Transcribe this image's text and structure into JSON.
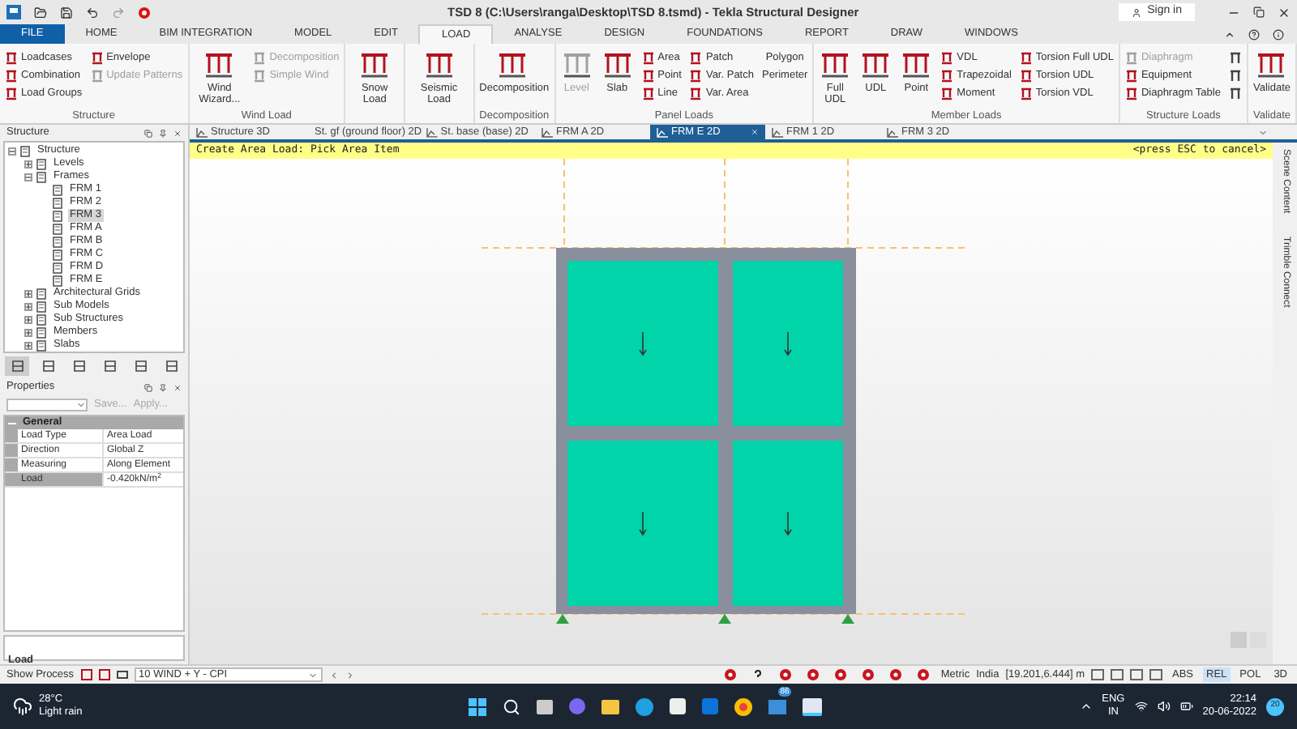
{
  "window": {
    "title": "TSD 8 (C:\\Users\\ranga\\Desktop\\TSD 8.tsmd) - Tekla Structural Designer",
    "sign_in": "Sign in"
  },
  "menu_tabs": [
    {
      "label": "FILE",
      "selected": false,
      "kind": "file"
    },
    {
      "label": "HOME",
      "selected": false,
      "kind": "tab"
    },
    {
      "label": "BIM INTEGRATION",
      "selected": false,
      "kind": "tab"
    },
    {
      "label": "MODEL",
      "selected": false,
      "kind": "tab"
    },
    {
      "label": "EDIT",
      "selected": false,
      "kind": "tab"
    },
    {
      "label": "LOAD",
      "selected": true,
      "kind": "tab"
    },
    {
      "label": "ANALYSE",
      "selected": false,
      "kind": "tab"
    },
    {
      "label": "DESIGN",
      "selected": false,
      "kind": "tab"
    },
    {
      "label": "FOUNDATIONS",
      "selected": false,
      "kind": "tab"
    },
    {
      "label": "REPORT",
      "selected": false,
      "kind": "tab"
    },
    {
      "label": "DRAW",
      "selected": false,
      "kind": "tab"
    },
    {
      "label": "WINDOWS",
      "selected": false,
      "kind": "tab"
    }
  ],
  "ribbon": [
    {
      "title": "Structure",
      "columns": [
        [
          {
            "label": "Loadcases",
            "kind": "small",
            "disabled": false
          },
          {
            "label": "Combination",
            "kind": "small",
            "disabled": false
          },
          {
            "label": "Load Groups",
            "kind": "small",
            "disabled": false
          }
        ],
        [
          {
            "label": "Envelope",
            "kind": "small",
            "disabled": false
          },
          {
            "label": "Update Patterns",
            "kind": "small",
            "disabled": true
          }
        ]
      ]
    },
    {
      "title": "Wind Load",
      "columns": [
        [
          {
            "label": "Wind Wizard...",
            "kind": "large",
            "disabled": false
          }
        ],
        [
          {
            "label": "Decomposition",
            "kind": "small",
            "disabled": true
          },
          {
            "label": "Simple Wind",
            "kind": "small",
            "disabled": true
          }
        ]
      ]
    },
    {
      "columns": [
        [
          {
            "label": "Snow Load",
            "kind": "large",
            "disabled": false
          }
        ]
      ]
    },
    {
      "columns": [
        [
          {
            "label": "Seismic Load",
            "kind": "large",
            "disabled": false
          }
        ]
      ]
    },
    {
      "title": "Decomposition",
      "columns": [
        [
          {
            "label": "Decomposition",
            "kind": "large",
            "disabled": false
          }
        ]
      ]
    },
    {
      "title": "Panel Loads",
      "columns": [
        [
          {
            "label": "Level",
            "kind": "large",
            "disabled": true
          }
        ],
        [
          {
            "label": "Slab",
            "kind": "large",
            "disabled": false
          }
        ],
        [
          {
            "label": "Area",
            "kind": "small",
            "disabled": false
          },
          {
            "label": "Point",
            "kind": "small",
            "disabled": false
          },
          {
            "label": "Line",
            "kind": "small",
            "disabled": false
          }
        ],
        [
          {
            "label": "Patch",
            "kind": "small",
            "disabled": false
          },
          {
            "label": "Var. Patch",
            "kind": "small",
            "disabled": false
          },
          {
            "label": "Var. Area",
            "kind": "small",
            "disabled": false
          }
        ],
        [
          {
            "label": "Polygon",
            "kind": "text",
            "disabled": false
          },
          {
            "label": "Perimeter",
            "kind": "text",
            "disabled": false
          }
        ]
      ]
    },
    {
      "title": "Member Loads",
      "columns": [
        [
          {
            "label": "Full UDL",
            "kind": "large",
            "disabled": false
          }
        ],
        [
          {
            "label": "UDL",
            "kind": "large",
            "disabled": false
          }
        ],
        [
          {
            "label": "Point",
            "kind": "large",
            "disabled": false
          }
        ],
        [
          {
            "label": "VDL",
            "kind": "small",
            "disabled": false
          },
          {
            "label": "Trapezoidal",
            "kind": "small",
            "disabled": false
          },
          {
            "label": "Moment",
            "kind": "small",
            "disabled": false
          }
        ],
        [
          {
            "label": "Torsion Full UDL",
            "kind": "small",
            "disabled": false
          },
          {
            "label": "Torsion UDL",
            "kind": "small",
            "disabled": false
          },
          {
            "label": "Torsion VDL",
            "kind": "small",
            "disabled": false
          }
        ]
      ]
    },
    {
      "title": "Structure Loads",
      "columns": [
        [
          {
            "label": "Diaphragm",
            "kind": "small",
            "disabled": true
          },
          {
            "label": "Equipment",
            "kind": "small",
            "disabled": false
          },
          {
            "label": "Diaphragm Table",
            "kind": "small",
            "disabled": false
          }
        ],
        [
          {
            "kind": "icon",
            "disabled": false
          },
          {
            "kind": "icon",
            "disabled": false
          },
          {
            "kind": "icon",
            "disabled": false
          }
        ]
      ]
    },
    {
      "title": "Validate",
      "columns": [
        [
          {
            "label": "Validate",
            "kind": "large",
            "disabled": false
          }
        ]
      ]
    }
  ],
  "doc_tabs": [
    {
      "label": "Structure 3D",
      "selected": false
    },
    {
      "label": "St. gf (ground floor) 2D",
      "selected": false
    },
    {
      "label": "St. base (base) 2D",
      "selected": false
    },
    {
      "label": "FRM A 2D",
      "selected": false
    },
    {
      "label": "FRM E 2D",
      "selected": true
    },
    {
      "label": "FRM 1 2D",
      "selected": false
    },
    {
      "label": "FRM 3 2D",
      "selected": false
    }
  ],
  "prompt": {
    "text": "Create Area Load: Pick Area Item",
    "hint": "<press ESC to cancel>"
  },
  "structure_panel": {
    "title": "Structure",
    "tree": [
      {
        "label": "Structure",
        "expanded": true,
        "selected": false,
        "children": [
          {
            "label": "Levels",
            "expanded": false,
            "selected": false
          },
          {
            "label": "Frames",
            "expanded": true,
            "selected": false,
            "children": [
              {
                "label": "FRM 1",
                "selected": false
              },
              {
                "label": "FRM 2",
                "selected": false
              },
              {
                "label": "FRM 3",
                "selected": true
              },
              {
                "label": "FRM A",
                "selected": false
              },
              {
                "label": "FRM B",
                "selected": false
              },
              {
                "label": "FRM C",
                "selected": false
              },
              {
                "label": "FRM D",
                "selected": false
              },
              {
                "label": "FRM E",
                "selected": false
              }
            ]
          },
          {
            "label": "Architectural Grids",
            "expanded": false,
            "selected": false
          },
          {
            "label": "Sub Models",
            "expanded": false,
            "selected": false
          },
          {
            "label": "Sub Structures",
            "expanded": false,
            "selected": false
          },
          {
            "label": "Members",
            "expanded": false,
            "selected": false
          },
          {
            "label": "Slabs",
            "expanded": false,
            "selected": false
          }
        ]
      }
    ]
  },
  "properties": {
    "title": "Properties",
    "save": "Save...",
    "apply": "Apply...",
    "section": "General",
    "expanded": true,
    "rows": [
      {
        "name": "Load Type",
        "value": "Area Load",
        "selected": false
      },
      {
        "name": "Direction",
        "value": "Global Z",
        "selected": false
      },
      {
        "name": "Measuring",
        "value": "Along Element",
        "selected": false
      },
      {
        "name": "Load",
        "value": "-0.420kN/m$^{2}$",
        "selected": true
      }
    ],
    "description": "Load"
  },
  "side_rail": [
    "Scene Content",
    "Trimble Connect"
  ],
  "status_bar": {
    "show_process": "Show Process",
    "combo": "10 WIND + Y - CPI",
    "units": "Metric",
    "region": "India",
    "coords": "[19.201,6.444] m",
    "modes": [
      {
        "label": "ABS",
        "selected": false
      },
      {
        "label": "REL",
        "selected": true
      },
      {
        "label": "POL",
        "selected": false
      },
      {
        "label": "3D",
        "selected": false
      }
    ]
  },
  "taskbar": {
    "temperature": "28°C",
    "weather": "Light rain",
    "mail_badge": "86",
    "lang": "ENG",
    "region": "IN",
    "time": "22:14",
    "date": "20-06-2022",
    "notifications": "20"
  }
}
